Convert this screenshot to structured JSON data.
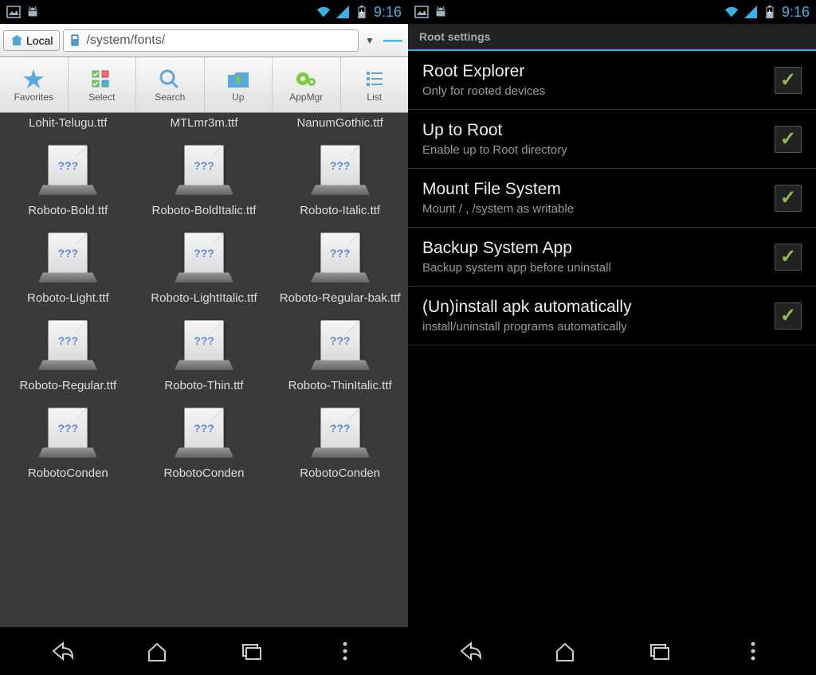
{
  "status": {
    "time": "9:16"
  },
  "left": {
    "local_label": "Local",
    "path": "/system/fonts/",
    "toolbar": [
      {
        "label": "Favorites",
        "icon": "star"
      },
      {
        "label": "Select",
        "icon": "select"
      },
      {
        "label": "Search",
        "icon": "search"
      },
      {
        "label": "Up",
        "icon": "up"
      },
      {
        "label": "AppMgr",
        "icon": "gear"
      },
      {
        "label": "List",
        "icon": "list"
      }
    ],
    "files": [
      {
        "name": "Lohit-Telugu.ttf",
        "partial_top": true
      },
      {
        "name": "MTLmr3m.ttf",
        "partial_top": true
      },
      {
        "name": "NanumGothic.ttf",
        "partial_top": true
      },
      {
        "name": "Roboto-Bold.ttf"
      },
      {
        "name": "Roboto-BoldItalic.ttf"
      },
      {
        "name": "Roboto-Italic.ttf"
      },
      {
        "name": "Roboto-Light.ttf"
      },
      {
        "name": "Roboto-LightItalic.ttf"
      },
      {
        "name": "Roboto-Regular-bak.ttf"
      },
      {
        "name": "Roboto-Regular.ttf"
      },
      {
        "name": "Roboto-Thin.ttf"
      },
      {
        "name": "Roboto-ThinItalic.ttf"
      },
      {
        "name": "RobotoConden"
      },
      {
        "name": "RobotoConden"
      },
      {
        "name": "RobotoConden"
      }
    ],
    "file_placeholder": "???"
  },
  "right": {
    "header": "Root settings",
    "items": [
      {
        "title": "Root Explorer",
        "sub": "Only for rooted devices",
        "checked": true
      },
      {
        "title": "Up to Root",
        "sub": "Enable up to Root directory",
        "checked": true
      },
      {
        "title": "Mount File System",
        "sub": "Mount / , /system as writable",
        "checked": true
      },
      {
        "title": "Backup System App",
        "sub": "Backup system app before uninstall",
        "checked": true
      },
      {
        "title": "(Un)install apk automatically",
        "sub": "install/uninstall programs automatically",
        "checked": true
      }
    ]
  }
}
